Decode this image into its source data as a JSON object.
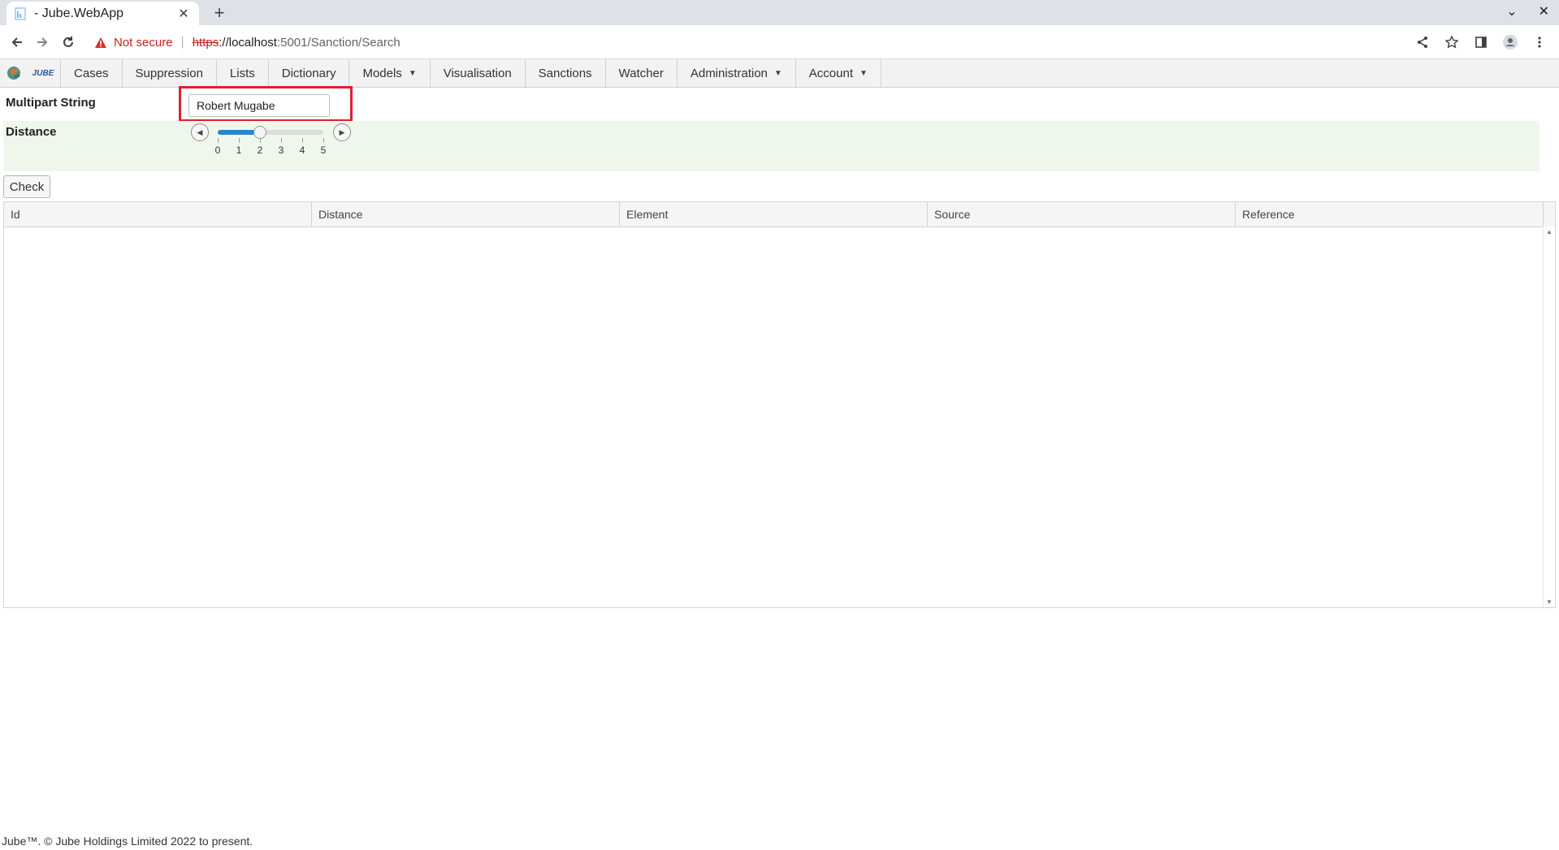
{
  "browser": {
    "tab_title": "- Jube.WebApp",
    "tab_close": "✕",
    "new_tab": "+",
    "window_controls": {
      "minimize": "⌄",
      "close": "✕"
    },
    "security_label": "Not secure",
    "url": {
      "scheme": "https",
      "host": "://localhost",
      "path": ":5001/Sanction/Search"
    }
  },
  "nav": {
    "logo_text": "JUBE",
    "items": [
      {
        "label": "Cases"
      },
      {
        "label": "Suppression"
      },
      {
        "label": "Lists"
      },
      {
        "label": "Dictionary"
      },
      {
        "label": "Models",
        "dropdown": true
      },
      {
        "label": "Visualisation"
      },
      {
        "label": "Sanctions"
      },
      {
        "label": "Watcher"
      },
      {
        "label": "Administration",
        "dropdown": true
      },
      {
        "label": "Account",
        "dropdown": true
      }
    ]
  },
  "form": {
    "multipart_label": "Multipart String",
    "multipart_value": "Robert Mugabe",
    "distance_label": "Distance",
    "distance": {
      "min": 0,
      "max": 5,
      "value": 2,
      "ticks": [
        "0",
        "1",
        "2",
        "3",
        "4",
        "5"
      ]
    },
    "check_label": "Check"
  },
  "grid": {
    "columns": [
      "Id",
      "Distance",
      "Element",
      "Source",
      "Reference"
    ],
    "rows": []
  },
  "footer": "Jube™. © Jube Holdings Limited 2022 to present.",
  "colors": {
    "highlight": "#e0202a",
    "slider_fill": "#2a86c8",
    "distance_row_bg": "#eff7ec"
  }
}
